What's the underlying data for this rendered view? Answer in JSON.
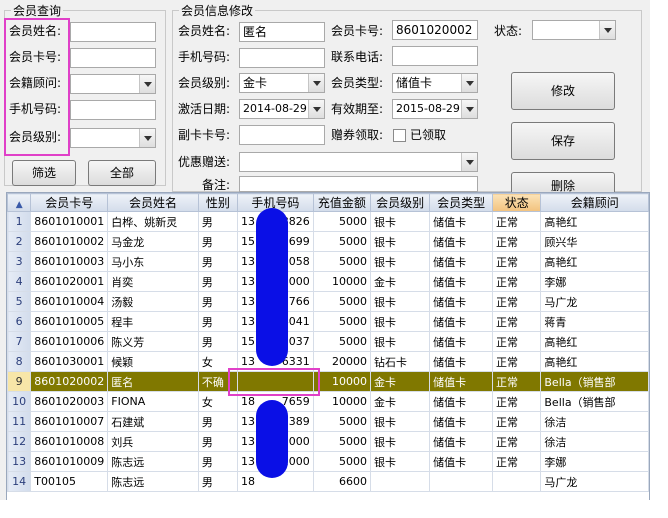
{
  "query": {
    "title": "会员查询",
    "fields": [
      {
        "label": "会员姓名:",
        "value": ""
      },
      {
        "label": "会员卡号:",
        "value": ""
      },
      {
        "label": "会籍顾问:",
        "value": ""
      },
      {
        "label": "手机号码:",
        "value": ""
      },
      {
        "label": "会员级别:",
        "value": ""
      }
    ],
    "filter_label": "筛选",
    "all_label": "全部"
  },
  "edit": {
    "title": "会员信息修改",
    "name_label": "会员姓名:",
    "name_value": "匿名",
    "card_label": "会员卡号:",
    "card_value": "8601020002",
    "status_label": "状态:",
    "status_value": "",
    "mobile_label": "手机号码:",
    "mobile_value": "",
    "phone_label": "联系电话:",
    "phone_value": "",
    "level_label": "会员级别:",
    "level_value": "金卡",
    "type_label": "会员类型:",
    "type_value": "储值卡",
    "activate_label": "激活日期:",
    "activate_value": "2014-08-29",
    "expire_label": "有效期至:",
    "expire_value": "2015-08-29",
    "subcard_label": "副卡卡号:",
    "subcard_value": "",
    "coupon_label": "赠券领取:",
    "coupon_check_label": "已领取",
    "promo_label": "优惠赠送:",
    "promo_value": "",
    "note_label": "备注:",
    "modify_label": "修改",
    "save_label": "保存",
    "delete_label": "删除"
  },
  "table": {
    "columns": [
      "会员卡号",
      "会员姓名",
      "性别",
      "手机号码",
      "充值金额",
      "会员级别",
      "会员类型",
      "状态",
      "会籍顾问"
    ],
    "selected_row": 9,
    "rows": [
      {
        "n": "1",
        "cells": [
          "8601010001",
          "白桦、姚新灵",
          "男",
          "13",
          "8826",
          "5000",
          "银卡",
          "储值卡",
          "正常",
          "高艳红"
        ]
      },
      {
        "n": "2",
        "cells": [
          "8601010002",
          "马金龙",
          "男",
          "15",
          "1699",
          "5000",
          "银卡",
          "储值卡",
          "正常",
          "顾兴华"
        ]
      },
      {
        "n": "3",
        "cells": [
          "8601010003",
          "马小东",
          "男",
          "13",
          "1058",
          "5000",
          "银卡",
          "储值卡",
          "正常",
          "高艳红"
        ]
      },
      {
        "n": "4",
        "cells": [
          "8601020001",
          "肖奕",
          "男",
          "13",
          "6000",
          "10000",
          "金卡",
          "储值卡",
          "正常",
          "李娜"
        ]
      },
      {
        "n": "5",
        "cells": [
          "8601010004",
          "汤毅",
          "男",
          "13",
          "1766",
          "5000",
          "银卡",
          "储值卡",
          "正常",
          "马广龙"
        ]
      },
      {
        "n": "6",
        "cells": [
          "8601010005",
          "程丰",
          "男",
          "13",
          "4041",
          "5000",
          "银卡",
          "储值卡",
          "正常",
          "蒋青"
        ]
      },
      {
        "n": "7",
        "cells": [
          "8601010006",
          "陈义芳",
          "男",
          "15",
          "2037",
          "5000",
          "银卡",
          "储值卡",
          "正常",
          "高艳红"
        ]
      },
      {
        "n": "8",
        "cells": [
          "8601030001",
          "候颖",
          "女",
          "13",
          "6331",
          "20000",
          "钻石卡",
          "储值卡",
          "正常",
          "高艳红"
        ]
      },
      {
        "n": "9",
        "cells": [
          "8601020002",
          "匿名",
          "不确",
          "",
          "",
          "10000",
          "金卡",
          "储值卡",
          "正常",
          "Bella（销售部"
        ]
      },
      {
        "n": "10",
        "cells": [
          "8601020003",
          "FIONA",
          "女",
          "18",
          "7659",
          "10000",
          "金卡",
          "储值卡",
          "正常",
          "Bella（销售部"
        ]
      },
      {
        "n": "11",
        "cells": [
          "8601010007",
          "石建斌",
          "男",
          "13",
          "3389",
          "5000",
          "银卡",
          "储值卡",
          "正常",
          "徐洁"
        ]
      },
      {
        "n": "12",
        "cells": [
          "8601010008",
          "刘兵",
          "男",
          "13",
          "0000",
          "5000",
          "银卡",
          "储值卡",
          "正常",
          "徐洁"
        ]
      },
      {
        "n": "13",
        "cells": [
          "8601010009",
          "陈志远",
          "男",
          "13",
          "2000",
          "5000",
          "银卡",
          "储值卡",
          "正常",
          "李娜"
        ]
      },
      {
        "n": "14",
        "cells": [
          "T00105",
          "陈志远",
          "男",
          "18",
          "",
          "6600",
          "",
          "",
          "",
          "马广龙"
        ]
      }
    ]
  },
  "colors": {
    "selected_row": "#807800",
    "highlight": "#e040c8",
    "redaction": "#0a0fe6",
    "sorted_header": "#f2c27e"
  }
}
